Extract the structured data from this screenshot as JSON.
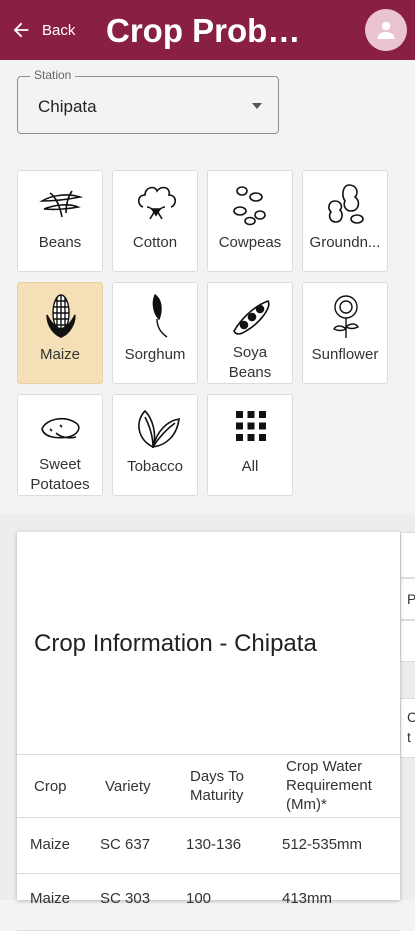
{
  "header": {
    "back_label": "Back",
    "title": "Crop Proba..."
  },
  "station": {
    "legend": "Station",
    "value": "Chipata"
  },
  "crops": [
    {
      "label": "Beans"
    },
    {
      "label": "Cotton"
    },
    {
      "label": "Cowpeas"
    },
    {
      "label": "Groundn..."
    },
    {
      "label": "Maize",
      "selected": true
    },
    {
      "label": "Sorghum"
    },
    {
      "label": "Soya",
      "label2": "Beans"
    },
    {
      "label": "Sunflower"
    },
    {
      "label": "Sweet",
      "label2": "Potatoes"
    },
    {
      "label": "Tobacco"
    },
    {
      "label": "All"
    }
  ],
  "crop_info": {
    "title": "Crop Information - Chipata",
    "columns": [
      "Crop",
      "Variety",
      "Days To",
      "Maturity",
      "Crop Water",
      "Requirement",
      "(Mm)*"
    ],
    "rows": [
      [
        "Maize",
        "SC 637",
        "130-136",
        "512-535mm"
      ],
      [
        "Maize",
        "SC 303",
        "100",
        "413mm"
      ]
    ]
  },
  "side_partial": {
    "a": "P",
    "b": "C",
    "c": "t"
  },
  "colors": {
    "brand": "#8a1f46",
    "selected_tile": "#f4dfb6"
  }
}
